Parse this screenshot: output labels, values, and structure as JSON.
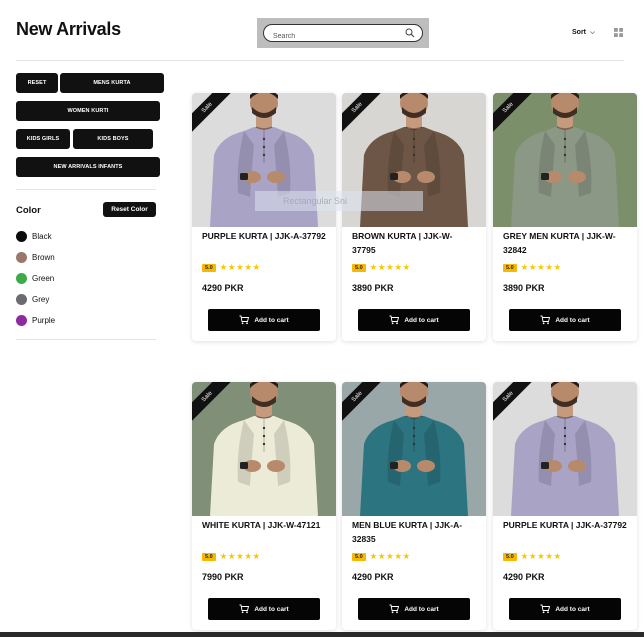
{
  "header": {
    "title": "New Arrivals",
    "search_placeholder": "Search",
    "sort_label": "Sort"
  },
  "filters": {
    "chips": [
      "RESET",
      "MENS KURTA",
      "WOMEN KURTI",
      "KIDS GIRLS",
      "KIDS BOYS",
      "NEW ARRIVALS INFANTS"
    ],
    "color_title": "Color",
    "reset_color_label": "Reset Color",
    "colors": [
      {
        "label": "Black",
        "hex": "#0b0b0b"
      },
      {
        "label": "Brown",
        "hex": "#9b776a"
      },
      {
        "label": "Green",
        "hex": "#3faa4b"
      },
      {
        "label": "Grey",
        "hex": "#6b6b70"
      },
      {
        "label": "Purple",
        "hex": "#8e2aa0"
      }
    ]
  },
  "products": [
    {
      "sale": "Sale",
      "name": "PURPLE KURTA | JJK-A-37792",
      "rating": "5.0",
      "stars": "★★★★★",
      "price": "4290 PKR",
      "cart_label": "Add to cart",
      "kurta_color": "#a9a3c6",
      "bg": "#dcdcdc",
      "icon": "man-purple-kurta-photo"
    },
    {
      "sale": "Sale",
      "name": "BROWN KURTA | JJK-W-37795",
      "rating": "5.0",
      "stars": "★★★★★",
      "price": "3890 PKR",
      "cart_label": "Add to cart",
      "kurta_color": "#6d5645",
      "bg": "#d8d6d2",
      "icon": "man-brown-kurta-photo"
    },
    {
      "sale": "Sale",
      "name": "GREY MEN KURTA | JJK-W-32842",
      "rating": "5.0",
      "stars": "★★★★★",
      "price": "3890 PKR",
      "cart_label": "Add to cart",
      "kurta_color": "#8c9886",
      "bg": "#7a8f6a",
      "icon": "man-grey-kurta-photo"
    },
    {
      "sale": "Sale",
      "name": "WHITE KURTA | JJK-W-47121",
      "rating": "5.0",
      "stars": "★★★★★",
      "price": "7990 PKR",
      "cart_label": "Add to cart",
      "kurta_color": "#ecebd8",
      "bg": "#7f8f78",
      "icon": "man-white-kurta-photo"
    },
    {
      "sale": "Sale",
      "name": "MEN BLUE KURTA | JJK-A-32835",
      "rating": "5.0",
      "stars": "★★★★★",
      "price": "4290 PKR",
      "cart_label": "Add to cart",
      "kurta_color": "#2b7480",
      "bg": "#9aa7a9",
      "icon": "man-blue-kurta-photo"
    },
    {
      "sale": "Sale",
      "name": "PURPLE KURTA | JJK-A-37792",
      "rating": "5.0",
      "stars": "★★★★★",
      "price": "4290 PKR",
      "cart_label": "Add to cart",
      "kurta_color": "#a9a3c6",
      "bg": "#dcdcdc",
      "icon": "man-purple-kurta-photo"
    }
  ],
  "overlay": {
    "text": "Rectangular Sni"
  }
}
